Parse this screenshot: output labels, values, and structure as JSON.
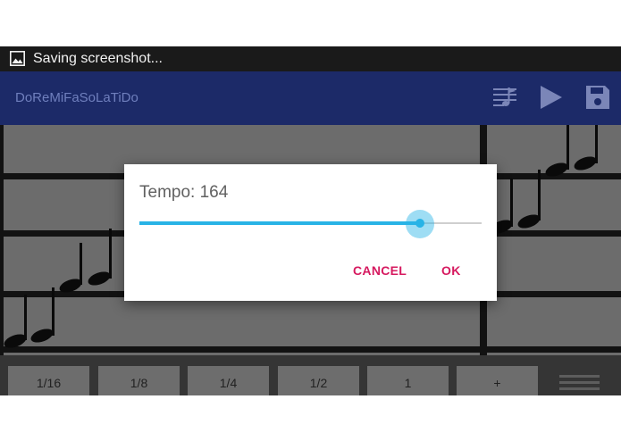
{
  "status_bar": {
    "text": "Saving screenshot...",
    "icon": "image-icon"
  },
  "app_bar": {
    "title": "DoReMiFaSoLaTiDo",
    "actions": [
      {
        "icon": "tempo-settings-icon"
      },
      {
        "icon": "play-icon"
      },
      {
        "icon": "save-icon"
      }
    ]
  },
  "note_durations": {
    "buttons": [
      "1/16",
      "1/8",
      "1/4",
      "1/2",
      "1",
      "+"
    ],
    "trailing_icon": "staff-lines-icon"
  },
  "dialog": {
    "title": "Tempo: 164",
    "slider": {
      "level_fraction": 0.82
    },
    "cancel_label": "CANCEL",
    "ok_label": "OK"
  },
  "colors": {
    "app_bar": "#1c2a68",
    "accent": "#28b3e6",
    "dialog_button": "#d6195f",
    "music_area": "#7c7c7c"
  }
}
